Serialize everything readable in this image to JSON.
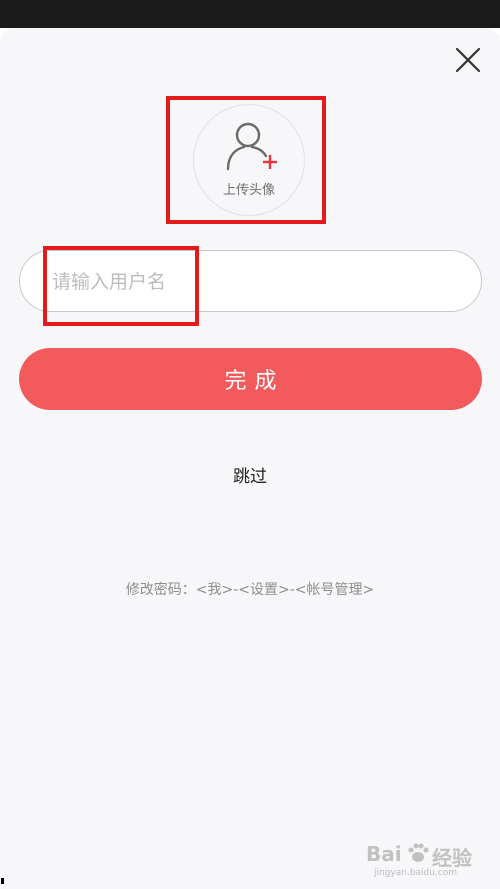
{
  "avatar": {
    "label": "上传头像"
  },
  "username": {
    "placeholder": "请输入用户名",
    "value": ""
  },
  "actions": {
    "done_label": "完成",
    "skip_label": "跳过"
  },
  "hint": {
    "text": "修改密码：<我>-<设置>-<帐号管理>"
  },
  "watermark": {
    "brand_left": "Bai",
    "brand_right": "经验",
    "url": "jingyan.baidu.com"
  },
  "colors": {
    "accent": "#f25a5c",
    "highlight": "#e31b1b",
    "avatar_plus": "#e8343a"
  },
  "icons": {
    "close": "close-icon",
    "user": "user-add-icon"
  }
}
